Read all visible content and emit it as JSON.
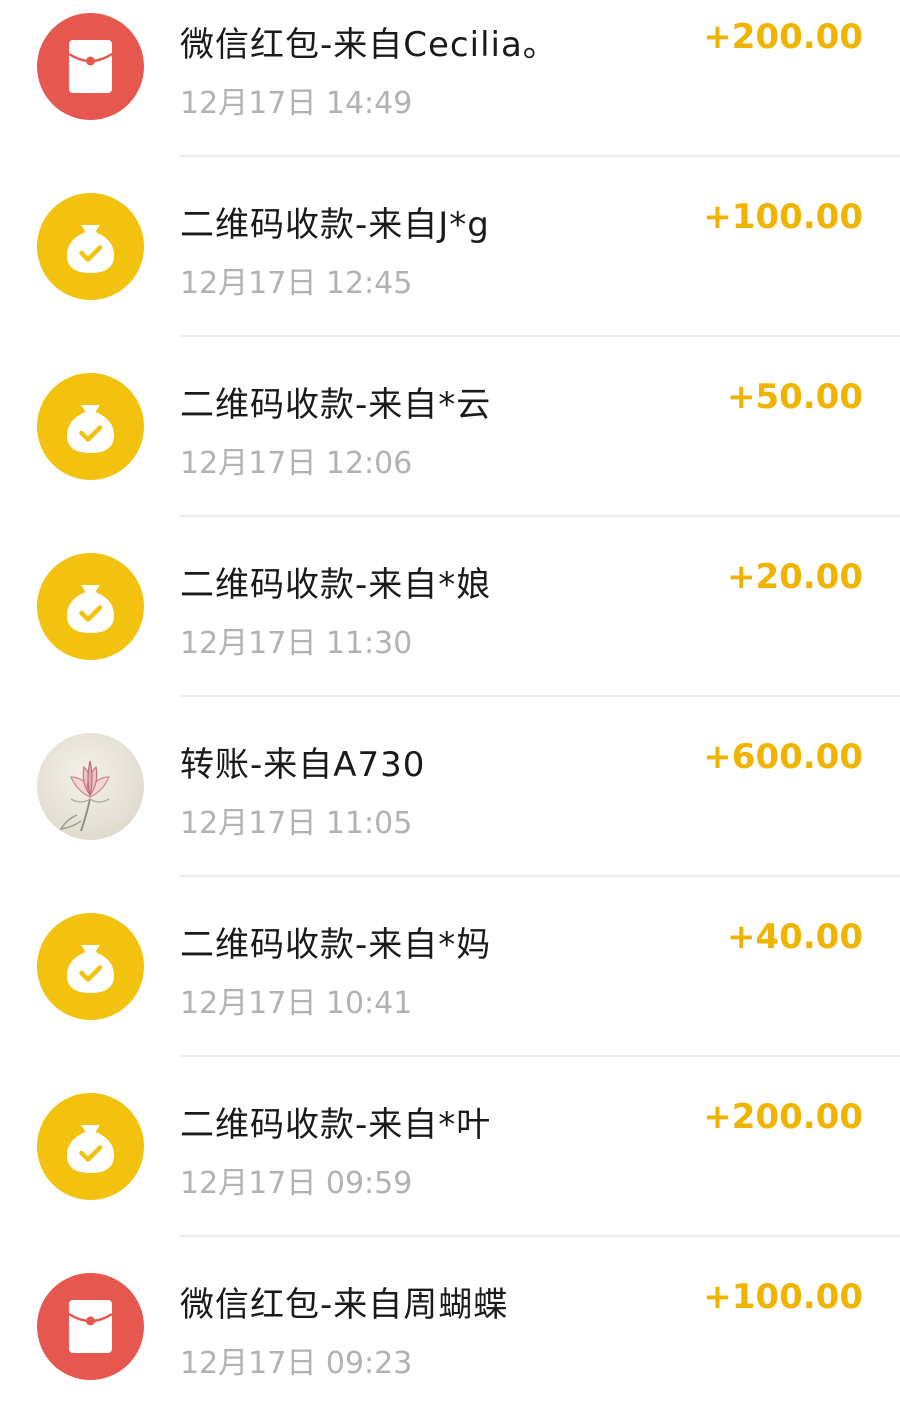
{
  "transactions": [
    {
      "kind": "red-packet",
      "title": "微信红包-来自Cecilia。",
      "time": "12月17日 14:49",
      "amount": "+200.00"
    },
    {
      "kind": "qr",
      "title": "二维码收款-来自J*g",
      "time": "12月17日 12:45",
      "amount": "+100.00"
    },
    {
      "kind": "qr",
      "title": "二维码收款-来自*云",
      "time": "12月17日 12:06",
      "amount": "+50.00"
    },
    {
      "kind": "qr",
      "title": "二维码收款-来自*娘",
      "time": "12月17日 11:30",
      "amount": "+20.00"
    },
    {
      "kind": "transfer",
      "title": "转账-来自A730",
      "time": "12月17日 11:05",
      "amount": "+600.00"
    },
    {
      "kind": "qr",
      "title": "二维码收款-来自*妈",
      "time": "12月17日 10:41",
      "amount": "+40.00"
    },
    {
      "kind": "qr",
      "title": "二维码收款-来自*叶",
      "time": "12月17日 09:59",
      "amount": "+200.00"
    },
    {
      "kind": "red-packet",
      "title": "微信红包-来自周蝴蝶",
      "time": "12月17日 09:23",
      "amount": "+100.00"
    }
  ],
  "icons": {
    "red-packet": "red-packet-icon",
    "qr": "money-bag-check-icon",
    "transfer": "lotus-avatar"
  },
  "colors": {
    "amount": "#f0b400",
    "red_packet_bg": "#e5574f",
    "qr_bg": "#f2c20f",
    "title": "#1a1a1a",
    "time": "#b2b2b2"
  }
}
